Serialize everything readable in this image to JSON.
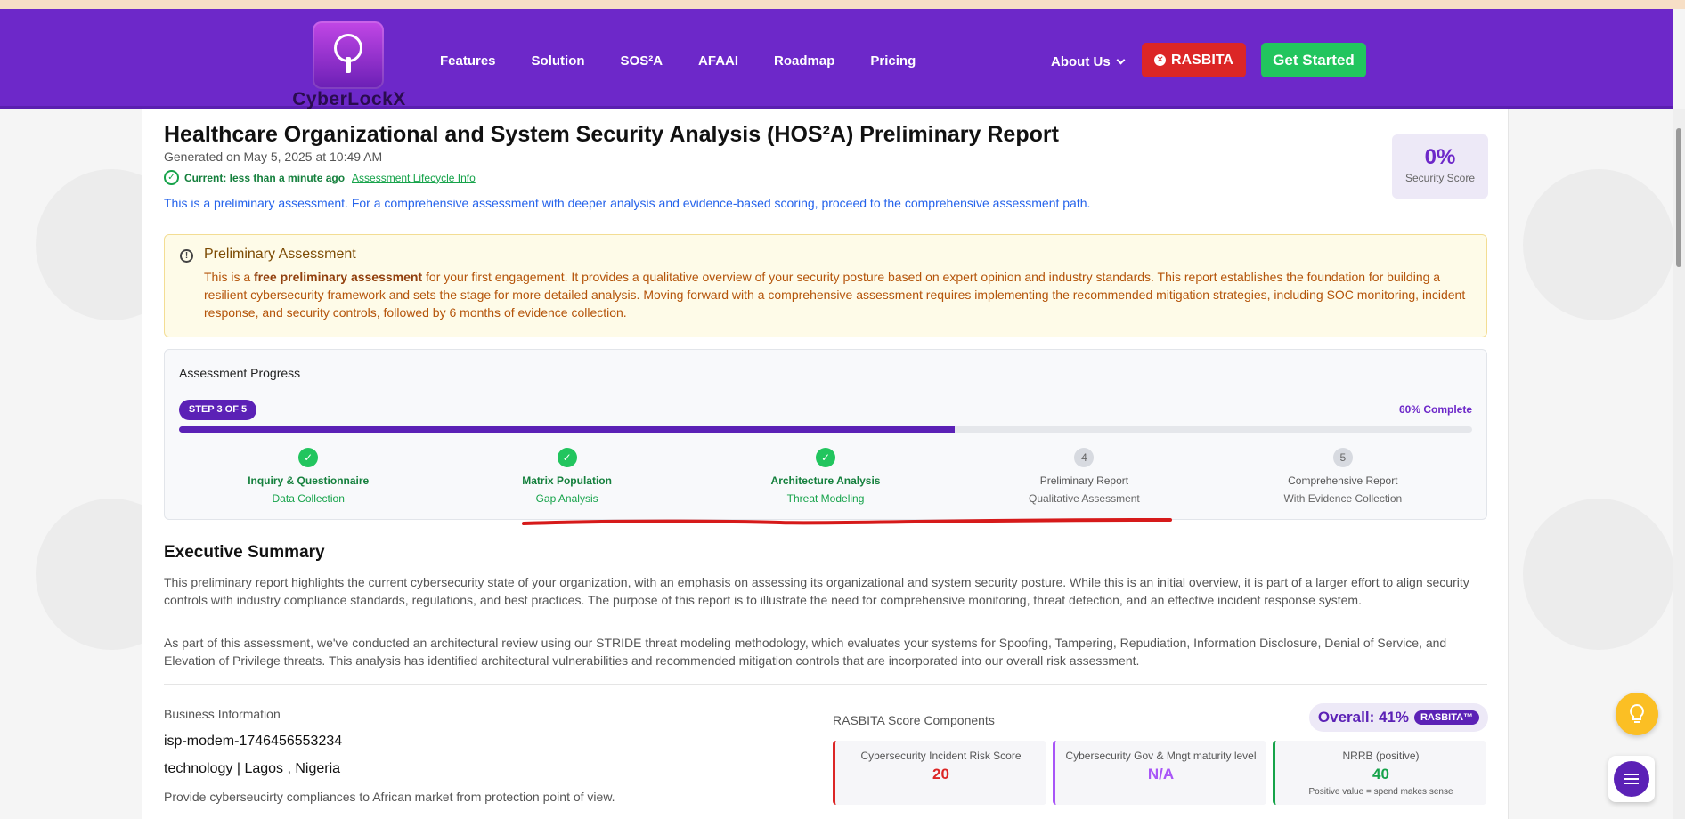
{
  "nav": {
    "logo_text": "CyberLockX",
    "links": [
      "Features",
      "Solution",
      "SOS²A",
      "AFAAI",
      "Roadmap",
      "Pricing"
    ],
    "about": "About Us",
    "rasbita_button": "RASBITA",
    "get_started": "Get Started"
  },
  "report": {
    "title": "Healthcare Organizational and System Security Analysis (HOS²A) Preliminary Report",
    "generated": "Generated on May 5, 2025 at 10:49 AM",
    "current": "Current: less than a minute ago",
    "lifecycle_link": "Assessment Lifecycle Info",
    "note": "This is a preliminary assessment. For a comprehensive assessment with deeper analysis and evidence-based scoring, proceed to the comprehensive assessment path.",
    "score_value": "0%",
    "score_label": "Security Score"
  },
  "alert": {
    "heading": "Preliminary Assessment",
    "body_pre": "This is a ",
    "body_bold": "free preliminary assessment",
    "body_post": " for your first engagement. It provides a qualitative overview of your security posture based on expert opinion and industry standards. This report establishes the foundation for building a resilient cybersecurity framework and sets the stage for more detailed analysis. Moving forward with a comprehensive assessment requires implementing the recommended mitigation strategies, including SOC monitoring, incident response, and security controls, followed by 6 months of evidence collection."
  },
  "progress": {
    "heading": "Assessment Progress",
    "step_pill": "STEP 3 OF 5",
    "complete_text": "60% Complete",
    "fraction": 0.6,
    "steps": [
      {
        "marker": "✓",
        "title": "Inquiry & Questionnaire",
        "sub": "Data Collection",
        "done": true
      },
      {
        "marker": "✓",
        "title": "Matrix Population",
        "sub": "Gap Analysis",
        "done": true
      },
      {
        "marker": "✓",
        "title": "Architecture Analysis",
        "sub": "Threat Modeling",
        "done": true
      },
      {
        "marker": "4",
        "title": "Preliminary Report",
        "sub": "Qualitative Assessment",
        "done": false
      },
      {
        "marker": "5",
        "title": "Comprehensive Report",
        "sub": "With Evidence Collection",
        "done": false
      }
    ]
  },
  "exec": {
    "heading": "Executive Summary",
    "p1": "This preliminary report highlights the current cybersecurity state of your organization, with an emphasis on assessing its organizational and system security posture. While this is an initial overview, it is part of a larger effort to align security controls with industry compliance standards, regulations, and best practices. The purpose of this report is to illustrate the need for comprehensive monitoring, threat detection, and an effective incident response system.",
    "p2": "As part of this assessment, we've conducted an architectural review using our STRIDE threat modeling methodology, which evaluates your systems for Spoofing, Tampering, Repudiation, Information Disclosure, Denial of Service, and Elevation of Privilege threats. This analysis has identified architectural vulnerabilities and recommended mitigation controls that are incorporated into our overall risk assessment."
  },
  "business": {
    "heading": "Business Information",
    "name": "isp-modem-1746456553234",
    "industry": "technology | Lagos , Nigeria",
    "description": "Provide cyberseucirty compliances to African market from protection point of view."
  },
  "rasbita": {
    "heading": "RASBITA Score Components",
    "overall": "Overall: 41%",
    "tag": "RASBITA™",
    "cards": [
      {
        "title": "Cybersecurity Incident Risk Score",
        "value": "20",
        "color": "#dc2626",
        "note": ""
      },
      {
        "title": "Cybersecurity Gov & Mngt maturity level",
        "value": "N/A",
        "color": "#a855f7",
        "note": ""
      },
      {
        "title": "NRRB (positive)",
        "value": "40",
        "color": "#16a34a",
        "note": "Positive value = spend makes sense"
      }
    ]
  }
}
